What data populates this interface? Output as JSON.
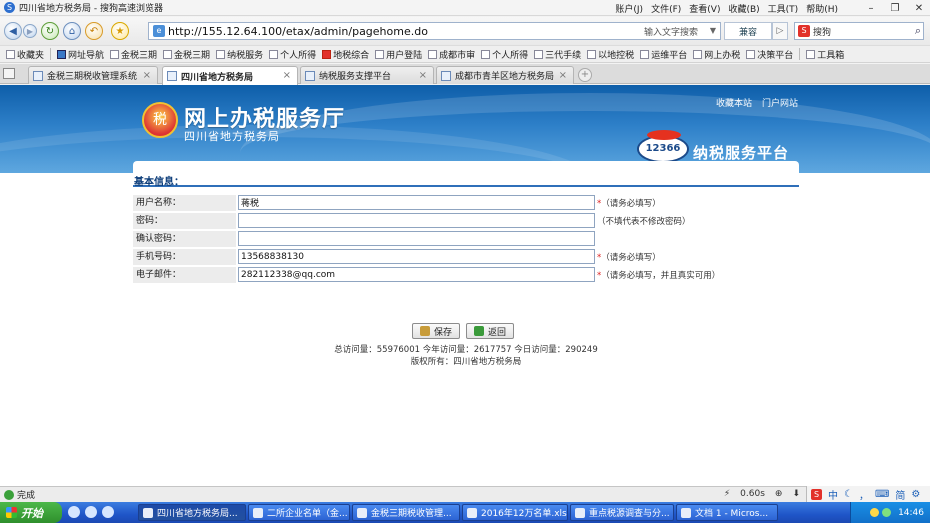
{
  "window": {
    "title": "四川省地方税务局 - 搜狗高速浏览器",
    "menus": [
      "账户(J)",
      "文件(F)",
      "查看(V)",
      "收藏(B)",
      "工具(T)",
      "帮助(H)"
    ],
    "controls": [
      "–",
      "❐",
      "✕"
    ]
  },
  "address_bar": {
    "url": "http://155.12.64.100/etax/admin/pagehome.do",
    "hint": "输入文字搜索",
    "compat_label": "兼容",
    "search_value": "搜狗"
  },
  "favorites": [
    "收藏夹",
    "网址导航",
    "金税三期",
    "金税三期",
    "纳税服务",
    "个人所得",
    "地税综合",
    "用户登陆",
    "成都市审",
    "个人所得",
    "三代手续",
    "以地控税",
    "运维平台",
    "网上办税",
    "决策平台",
    "工具箱"
  ],
  "tabs": [
    {
      "label": "金税三期税收管理系统",
      "active": false
    },
    {
      "label": "四川省地方税务局",
      "active": true
    },
    {
      "label": "纳税服务支撑平台",
      "active": false
    },
    {
      "label": "成都市青羊区地方税务局",
      "active": false
    }
  ],
  "banner": {
    "top_links": [
      "收藏本站",
      "门户网站"
    ],
    "brand": "网上办税服务厅",
    "brand_sub": "四川省地方税务局",
    "platform_logo": "12366",
    "platform_name": "纳税服务平台"
  },
  "form": {
    "section_title": "基本信息：",
    "rows": [
      {
        "label": "用户名称：",
        "value": "蒋税",
        "note_star": "*",
        "note": "（请务必填写）"
      },
      {
        "label": "密码：",
        "value": "",
        "note_star": "",
        "note": "（不填代表不修改密码）"
      },
      {
        "label": "确认密码：",
        "value": "",
        "note_star": "",
        "note": ""
      },
      {
        "label": "手机号码：",
        "value": "13568838130",
        "note_star": "*",
        "note": "（请务必填写）"
      },
      {
        "label": "电子邮件：",
        "value": "282112338@qq.com",
        "note_star": "*",
        "note": "（请务必填写，并且真实可用）"
      }
    ],
    "save_label": "保存",
    "back_label": "返回",
    "stats": "总访问量：55976001 今年访问量：2617757 今日访问量：290249",
    "copyright": "版权所有：四川省地方税务局"
  },
  "status": {
    "text": "完成",
    "load_time": "0.60s"
  },
  "taskbar": {
    "start_label": "开始",
    "items": [
      {
        "label": "四川省地方税务局...",
        "active": true
      },
      {
        "label": "二所企业名单（金...",
        "active": false
      },
      {
        "label": "金税三期税收管理...",
        "active": false
      },
      {
        "label": "2016年12万名单.xlsx",
        "active": false
      },
      {
        "label": "重点税源调查与分...",
        "active": false
      },
      {
        "label": "文档 1 - Micros...",
        "active": false
      }
    ],
    "clock": "14:46",
    "ime": [
      "中",
      "简"
    ]
  }
}
